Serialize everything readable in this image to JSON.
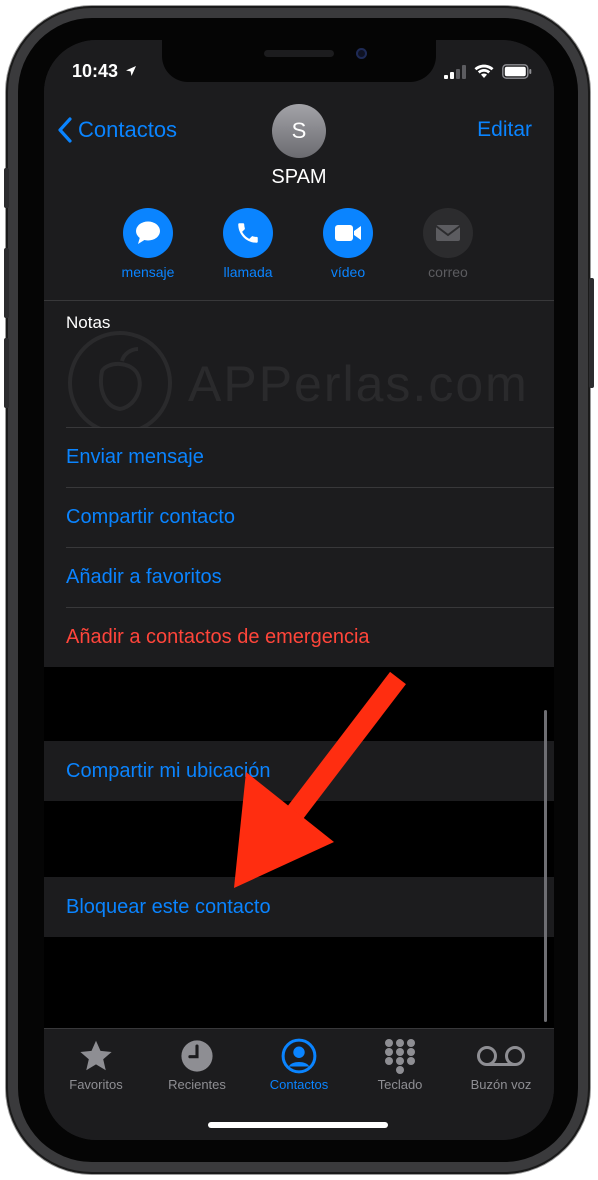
{
  "status_bar": {
    "time": "10:43"
  },
  "nav": {
    "back_label": "Contactos",
    "edit_label": "Editar"
  },
  "contact": {
    "initial": "S",
    "name": "SPAM"
  },
  "actions": [
    {
      "label": "mensaje",
      "icon": "message-icon",
      "enabled": true
    },
    {
      "label": "llamada",
      "icon": "phone-icon",
      "enabled": true
    },
    {
      "label": "vídeo",
      "icon": "video-icon",
      "enabled": true
    },
    {
      "label": "correo",
      "icon": "mail-icon",
      "enabled": false
    }
  ],
  "notes": {
    "label": "Notas"
  },
  "watermark": {
    "text": "APPerlas.com"
  },
  "options": [
    {
      "label": "Enviar mensaje",
      "style": "blue"
    },
    {
      "label": "Compartir contacto",
      "style": "blue"
    },
    {
      "label": "Añadir a favoritos",
      "style": "blue"
    },
    {
      "label": "Añadir a contactos de emergencia",
      "style": "red"
    }
  ],
  "location": {
    "label": "Compartir mi ubicación"
  },
  "block": {
    "label": "Bloquear este contacto"
  },
  "tabbar": [
    {
      "label": "Favoritos",
      "icon": "star-icon",
      "active": false
    },
    {
      "label": "Recientes",
      "icon": "clock-icon",
      "active": false
    },
    {
      "label": "Contactos",
      "icon": "person-circle-icon",
      "active": true
    },
    {
      "label": "Teclado",
      "icon": "keypad-icon",
      "active": false
    },
    {
      "label": "Buzón voz",
      "icon": "voicemail-icon",
      "active": false
    }
  ],
  "colors": {
    "accent": "#0a84ff",
    "destructive": "#ff453a",
    "annotation_arrow": "#ff2d10",
    "background": "#000000",
    "cell": "#1c1c1e"
  }
}
